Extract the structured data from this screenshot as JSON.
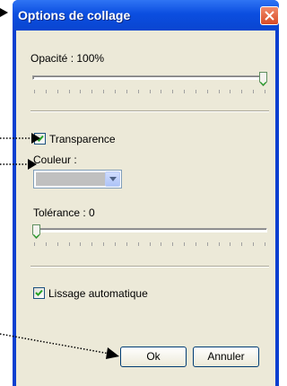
{
  "window": {
    "title": "Options de collage"
  },
  "opacity": {
    "label": "Opacité : 100%",
    "value_percent": 100
  },
  "transparency": {
    "label": "Transparence",
    "checked": true
  },
  "color": {
    "label": "Couleur :",
    "swatch": "#c0c0c0"
  },
  "tolerance": {
    "label": "Tolérance : 0",
    "value": 0
  },
  "smoothing": {
    "label": "Lissage automatique",
    "checked": true
  },
  "buttons": {
    "ok_label": "Ok",
    "cancel_label": "Annuler"
  },
  "colors": {
    "titlebar": "#0a4ee0",
    "client": "#ece9d8",
    "close": "#d84a26",
    "check": "#21a121"
  }
}
